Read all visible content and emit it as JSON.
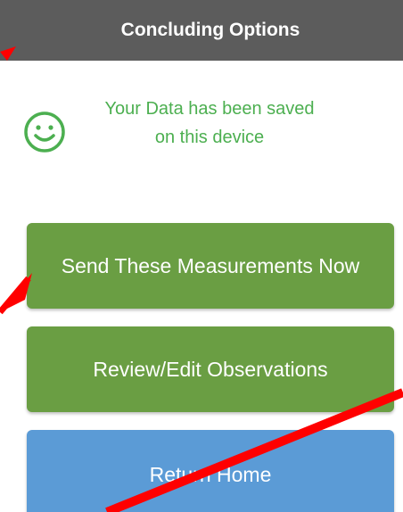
{
  "header": {
    "title": "Concluding Options"
  },
  "status": {
    "icon": "smiley-icon",
    "message": "Your Data has been saved on this device",
    "color": "#4caf50"
  },
  "actions": {
    "send_label": "Send These Measurements Now",
    "review_label": "Review/Edit Observations",
    "home_label": "Return Home"
  },
  "colors": {
    "header_bg": "#5c5c5c",
    "action_green": "#6a9e43",
    "action_blue": "#5b9bd6",
    "annotation_red": "#ff0000"
  }
}
